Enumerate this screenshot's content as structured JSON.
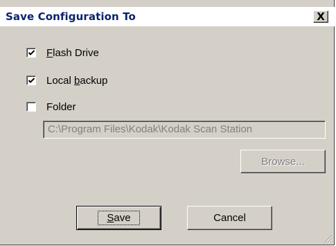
{
  "dialog": {
    "title": "Save Configuration To",
    "close_label": "X"
  },
  "options": [
    {
      "pre": "",
      "access": "F",
      "post": "lash Drive",
      "checked": true
    },
    {
      "pre": "Local ",
      "access": "b",
      "post": "ackup",
      "checked": true
    },
    {
      "pre": "Folder",
      "access": "",
      "post": "",
      "checked": false
    }
  ],
  "folder_path": {
    "value": "C:\\Program Files\\Kodak\\Kodak Scan Station",
    "disabled": true
  },
  "buttons": {
    "browse_label": "Browse...",
    "save_pre": "",
    "save_access": "S",
    "save_post": "ave",
    "cancel_label": "Cancel"
  }
}
